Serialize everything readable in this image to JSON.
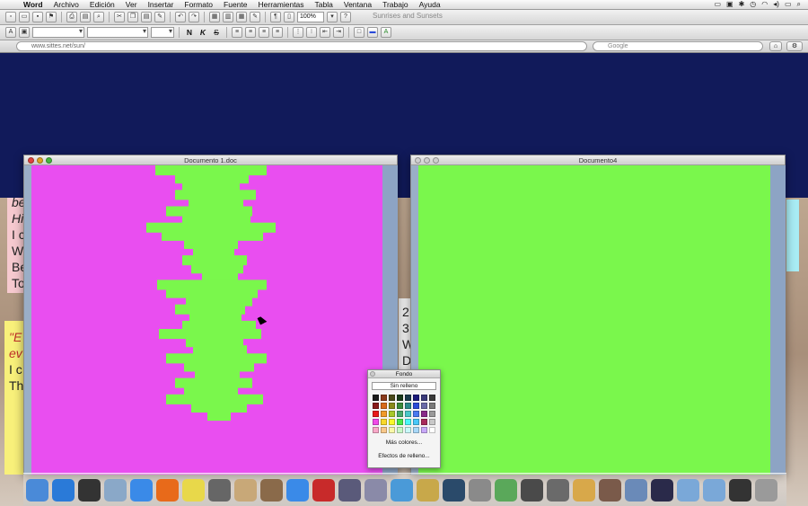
{
  "menubar": {
    "apple_icon": "apple-icon",
    "items": [
      "Word",
      "Archivo",
      "Edición",
      "Ver",
      "Insertar",
      "Formato",
      "Fuente",
      "Herramientas",
      "Tabla",
      "Ventana",
      "Trabajo",
      "Ayuda"
    ]
  },
  "toolbar": {
    "zoom": "100%",
    "bold": "N",
    "italic": "K",
    "strike": "S",
    "window_hint": "Sunrises and Sunsets"
  },
  "browser": {
    "url": "www.sittes.net/sun/",
    "search_placeholder": "Google"
  },
  "background_text": {
    "left_block_a": [
      "be",
      "Hi",
      "I c",
      "W",
      "Be",
      "To"
    ],
    "left_block_b": [
      "\"E",
      "ev",
      "I c",
      "Th"
    ],
    "middle_block": [
      "2",
      "3",
      "W",
      "D"
    ]
  },
  "windows": {
    "doc1": {
      "title": "Documento 1.doc",
      "page_color": "#e94ef0",
      "shape_color": "#7af74c"
    },
    "doc4": {
      "title": "Documento4",
      "page_color": "#7af74c"
    }
  },
  "palette": {
    "title": "Fondo",
    "no_fill": "Sin relleno",
    "more_colors": "Más colores...",
    "fill_effects": "Efectos de relleno...",
    "colors": [
      "#1a1a1a",
      "#8a3a1a",
      "#4a4a1a",
      "#1a3a1a",
      "#1a3a4a",
      "#1a1a7a",
      "#3a3a7a",
      "#3a3a3a",
      "#8a1a1a",
      "#d86a1a",
      "#8a8a1a",
      "#3a8a3a",
      "#2a8a8a",
      "#2a4ad8",
      "#6a6aa8",
      "#7a7a7a",
      "#e81a1a",
      "#f09a2a",
      "#a8c82a",
      "#4aa86a",
      "#4ac8c8",
      "#4a7af0",
      "#8a2a8a",
      "#9a9a9a",
      "#f04ae8",
      "#f8d82a",
      "#f8f82a",
      "#4ae84a",
      "#4af8f8",
      "#4ac8f8",
      "#a82a5a",
      "#c8c8c8",
      "#f8a8c8",
      "#f8c88a",
      "#f8f8a8",
      "#c8f8c8",
      "#c8f8f8",
      "#a8d8f8",
      "#c8a8f8",
      "#ffffff"
    ]
  },
  "dock_icons": [
    {
      "name": "finder-icon",
      "color": "#4a8ad8"
    },
    {
      "name": "app-store-icon",
      "color": "#2a7ad8"
    },
    {
      "name": "dashboard-icon",
      "color": "#333"
    },
    {
      "name": "preview-icon",
      "color": "#8aa8c8"
    },
    {
      "name": "safari-icon",
      "color": "#3a8ae8"
    },
    {
      "name": "firefox-icon",
      "color": "#e86a1a"
    },
    {
      "name": "stickies-icon",
      "color": "#e8d84a"
    },
    {
      "name": "screen-capture-icon",
      "color": "#666"
    },
    {
      "name": "address-book-icon",
      "color": "#c8a878"
    },
    {
      "name": "photo-icon",
      "color": "#8a6a4a"
    },
    {
      "name": "itunes-icon",
      "color": "#3a8ae8"
    },
    {
      "name": "red-book-icon",
      "color": "#c82a2a"
    },
    {
      "name": "iphoto-icon",
      "color": "#5a5a7a"
    },
    {
      "name": "photo-booth-icon",
      "color": "#8a8aa8"
    },
    {
      "name": "hands-icon",
      "color": "#4a9ad8"
    },
    {
      "name": "garageband-icon",
      "color": "#c8a84a"
    },
    {
      "name": "time-machine-icon",
      "color": "#2a4a6a"
    },
    {
      "name": "system-preferences-icon",
      "color": "#8a8a8a"
    },
    {
      "name": "pencil-icon",
      "color": "#5aa85a"
    },
    {
      "name": "scanner-icon",
      "color": "#4a4a4a"
    },
    {
      "name": "printer-icon",
      "color": "#6a6a6a"
    },
    {
      "name": "iwork-icon",
      "color": "#d8a84a"
    },
    {
      "name": "scissors-icon",
      "color": "#7a5a4a"
    },
    {
      "name": "mail-icon",
      "color": "#6a8ab8"
    },
    {
      "name": "video-icon",
      "color": "#2a2a4a"
    },
    {
      "name": "applications-folder-icon",
      "color": "#7aa8d8"
    },
    {
      "name": "documents-folder-icon",
      "color": "#7aa8d8"
    },
    {
      "name": "music-icon",
      "color": "#333"
    },
    {
      "name": "trash-icon",
      "color": "#9a9a9a"
    }
  ]
}
